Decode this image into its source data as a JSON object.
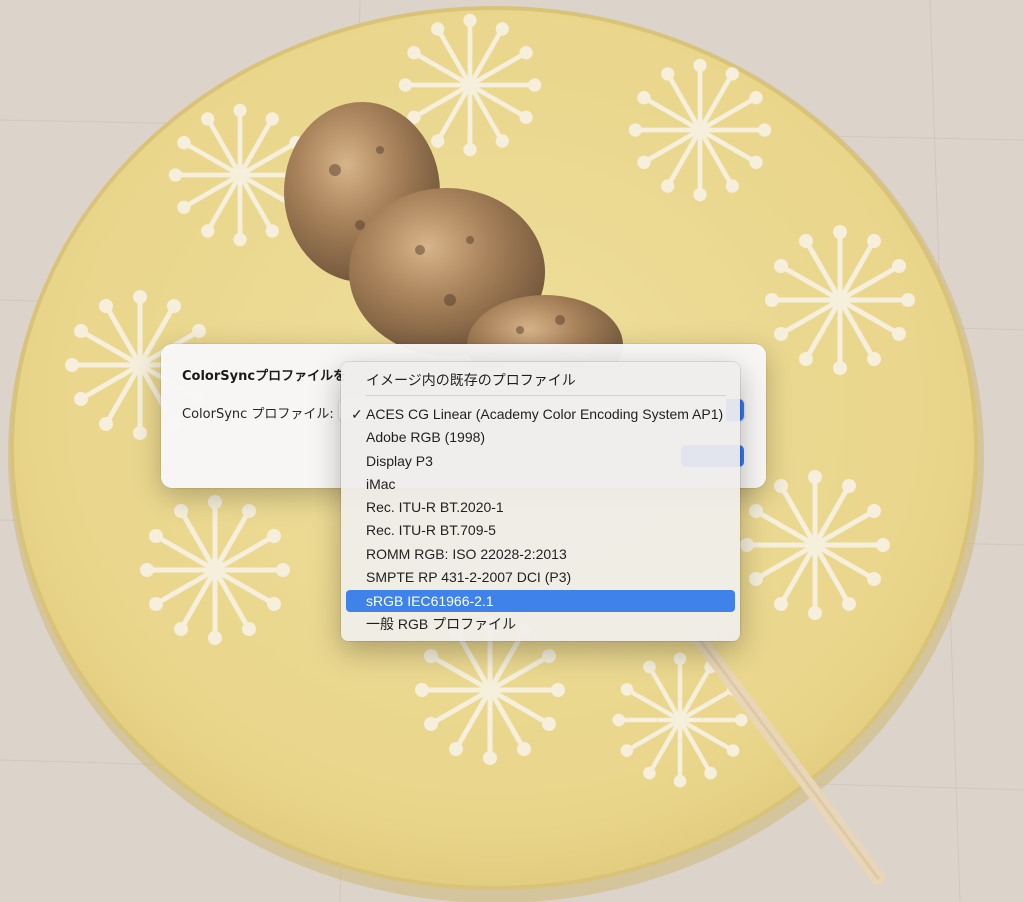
{
  "dialog": {
    "title": "ColorSyncプロファイルを",
    "profile_label": "ColorSync プロファイル:"
  },
  "menu": {
    "items": [
      {
        "label": "イメージ内の既存のプロファイル",
        "checked": false,
        "highlighted": false
      },
      {
        "label": "ACES CG Linear (Academy Color Encoding System AP1)",
        "checked": true,
        "highlighted": false
      },
      {
        "label": "Adobe RGB (1998)",
        "checked": false,
        "highlighted": false
      },
      {
        "label": "Display P3",
        "checked": false,
        "highlighted": false
      },
      {
        "label": "iMac",
        "checked": false,
        "highlighted": false
      },
      {
        "label": "Rec. ITU-R BT.2020-1",
        "checked": false,
        "highlighted": false
      },
      {
        "label": "Rec. ITU-R BT.709-5",
        "checked": false,
        "highlighted": false
      },
      {
        "label": "ROMM RGB: ISO 22028-2:2013",
        "checked": false,
        "highlighted": false
      },
      {
        "label": "SMPTE RP 431-2-2007 DCI (P3)",
        "checked": false,
        "highlighted": false
      },
      {
        "label": "sRGB IEC61966-2.1",
        "checked": false,
        "highlighted": true
      },
      {
        "label": "一般 RGB プロファイル",
        "checked": false,
        "highlighted": false
      }
    ],
    "checkmark": "✓"
  },
  "colors": {
    "accent": "#3478f6",
    "highlight": "#3f82ea",
    "plate": "#ecd993",
    "table": "#dcd3ca"
  }
}
